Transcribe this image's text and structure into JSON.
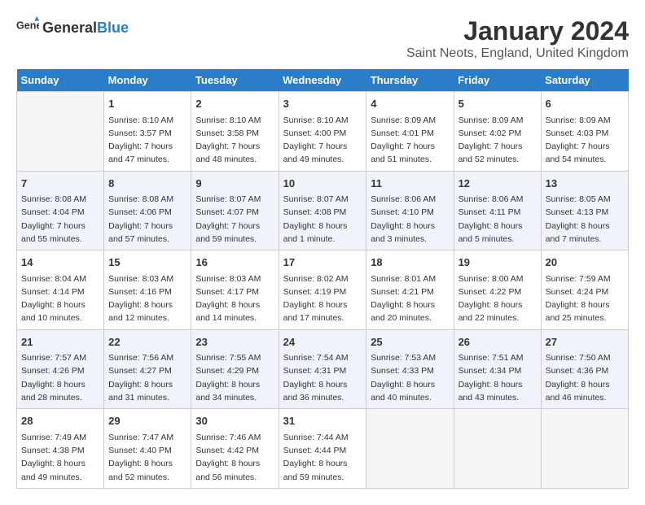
{
  "header": {
    "logo_general": "General",
    "logo_blue": "Blue",
    "title": "January 2024",
    "subtitle": "Saint Neots, England, United Kingdom"
  },
  "weekdays": [
    "Sunday",
    "Monday",
    "Tuesday",
    "Wednesday",
    "Thursday",
    "Friday",
    "Saturday"
  ],
  "weeks": [
    [
      {
        "day": "",
        "info": ""
      },
      {
        "day": "1",
        "info": "Sunrise: 8:10 AM\nSunset: 3:57 PM\nDaylight: 7 hours\nand 47 minutes."
      },
      {
        "day": "2",
        "info": "Sunrise: 8:10 AM\nSunset: 3:58 PM\nDaylight: 7 hours\nand 48 minutes."
      },
      {
        "day": "3",
        "info": "Sunrise: 8:10 AM\nSunset: 4:00 PM\nDaylight: 7 hours\nand 49 minutes."
      },
      {
        "day": "4",
        "info": "Sunrise: 8:09 AM\nSunset: 4:01 PM\nDaylight: 7 hours\nand 51 minutes."
      },
      {
        "day": "5",
        "info": "Sunrise: 8:09 AM\nSunset: 4:02 PM\nDaylight: 7 hours\nand 52 minutes."
      },
      {
        "day": "6",
        "info": "Sunrise: 8:09 AM\nSunset: 4:03 PM\nDaylight: 7 hours\nand 54 minutes."
      }
    ],
    [
      {
        "day": "7",
        "info": "Sunrise: 8:08 AM\nSunset: 4:04 PM\nDaylight: 7 hours\nand 55 minutes."
      },
      {
        "day": "8",
        "info": "Sunrise: 8:08 AM\nSunset: 4:06 PM\nDaylight: 7 hours\nand 57 minutes."
      },
      {
        "day": "9",
        "info": "Sunrise: 8:07 AM\nSunset: 4:07 PM\nDaylight: 7 hours\nand 59 minutes."
      },
      {
        "day": "10",
        "info": "Sunrise: 8:07 AM\nSunset: 4:08 PM\nDaylight: 8 hours\nand 1 minute."
      },
      {
        "day": "11",
        "info": "Sunrise: 8:06 AM\nSunset: 4:10 PM\nDaylight: 8 hours\nand 3 minutes."
      },
      {
        "day": "12",
        "info": "Sunrise: 8:06 AM\nSunset: 4:11 PM\nDaylight: 8 hours\nand 5 minutes."
      },
      {
        "day": "13",
        "info": "Sunrise: 8:05 AM\nSunset: 4:13 PM\nDaylight: 8 hours\nand 7 minutes."
      }
    ],
    [
      {
        "day": "14",
        "info": "Sunrise: 8:04 AM\nSunset: 4:14 PM\nDaylight: 8 hours\nand 10 minutes."
      },
      {
        "day": "15",
        "info": "Sunrise: 8:03 AM\nSunset: 4:16 PM\nDaylight: 8 hours\nand 12 minutes."
      },
      {
        "day": "16",
        "info": "Sunrise: 8:03 AM\nSunset: 4:17 PM\nDaylight: 8 hours\nand 14 minutes."
      },
      {
        "day": "17",
        "info": "Sunrise: 8:02 AM\nSunset: 4:19 PM\nDaylight: 8 hours\nand 17 minutes."
      },
      {
        "day": "18",
        "info": "Sunrise: 8:01 AM\nSunset: 4:21 PM\nDaylight: 8 hours\nand 20 minutes."
      },
      {
        "day": "19",
        "info": "Sunrise: 8:00 AM\nSunset: 4:22 PM\nDaylight: 8 hours\nand 22 minutes."
      },
      {
        "day": "20",
        "info": "Sunrise: 7:59 AM\nSunset: 4:24 PM\nDaylight: 8 hours\nand 25 minutes."
      }
    ],
    [
      {
        "day": "21",
        "info": "Sunrise: 7:57 AM\nSunset: 4:26 PM\nDaylight: 8 hours\nand 28 minutes."
      },
      {
        "day": "22",
        "info": "Sunrise: 7:56 AM\nSunset: 4:27 PM\nDaylight: 8 hours\nand 31 minutes."
      },
      {
        "day": "23",
        "info": "Sunrise: 7:55 AM\nSunset: 4:29 PM\nDaylight: 8 hours\nand 34 minutes."
      },
      {
        "day": "24",
        "info": "Sunrise: 7:54 AM\nSunset: 4:31 PM\nDaylight: 8 hours\nand 36 minutes."
      },
      {
        "day": "25",
        "info": "Sunrise: 7:53 AM\nSunset: 4:33 PM\nDaylight: 8 hours\nand 40 minutes."
      },
      {
        "day": "26",
        "info": "Sunrise: 7:51 AM\nSunset: 4:34 PM\nDaylight: 8 hours\nand 43 minutes."
      },
      {
        "day": "27",
        "info": "Sunrise: 7:50 AM\nSunset: 4:36 PM\nDaylight: 8 hours\nand 46 minutes."
      }
    ],
    [
      {
        "day": "28",
        "info": "Sunrise: 7:49 AM\nSunset: 4:38 PM\nDaylight: 8 hours\nand 49 minutes."
      },
      {
        "day": "29",
        "info": "Sunrise: 7:47 AM\nSunset: 4:40 PM\nDaylight: 8 hours\nand 52 minutes."
      },
      {
        "day": "30",
        "info": "Sunrise: 7:46 AM\nSunset: 4:42 PM\nDaylight: 8 hours\nand 56 minutes."
      },
      {
        "day": "31",
        "info": "Sunrise: 7:44 AM\nSunset: 4:44 PM\nDaylight: 8 hours\nand 59 minutes."
      },
      {
        "day": "",
        "info": ""
      },
      {
        "day": "",
        "info": ""
      },
      {
        "day": "",
        "info": ""
      }
    ]
  ]
}
